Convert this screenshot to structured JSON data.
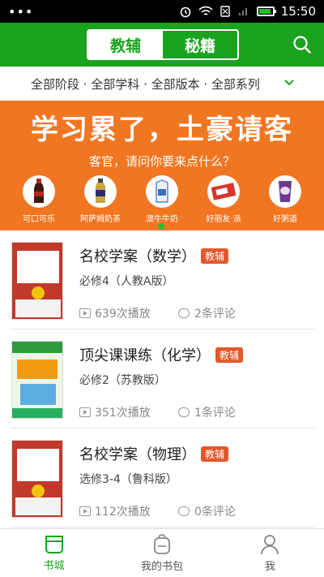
{
  "status_bar": {
    "time": "15:50",
    "dots": "•••"
  },
  "header": {
    "tabs": [
      {
        "label": "教辅",
        "active": true
      },
      {
        "label": "秘籍",
        "active": false
      }
    ]
  },
  "filter": {
    "text": "全部阶段 · 全部学科 · 全部版本 · 全部系列"
  },
  "banner": {
    "title": "学习累了，土豪请客",
    "subtitle": "客官，请问你要来点什么？",
    "products": [
      {
        "label": "可口可乐",
        "color": "#b3261e"
      },
      {
        "label": "阿萨姆奶茶",
        "color": "#c9a24a"
      },
      {
        "label": "澳牛牛奶",
        "color": "#3b6fb6"
      },
      {
        "label": "好丽友·派",
        "color": "#d9342b"
      },
      {
        "label": "好粥道",
        "color": "#6a3a8c"
      }
    ]
  },
  "items": [
    {
      "title": "名校学案（数学）",
      "tag": "教辅",
      "edition": "必修4（人教A版）",
      "plays": "639次播放",
      "comments": "2条评论",
      "cover_text": "名校学案",
      "cover_color": "#c0392b"
    },
    {
      "title": "顶尖课课练（化学）",
      "tag": "教辅",
      "edition": "必修2（苏教版）",
      "plays": "351次播放",
      "comments": "1条评论",
      "cover_text": "顶尖课课练",
      "cover_color": "#2e9b3d"
    },
    {
      "title": "名校学案（物理）",
      "tag": "教辅",
      "edition": "选修3-4（鲁科版）",
      "plays": "112次播放",
      "comments": "0条评论",
      "cover_text": "名校学案",
      "cover_color": "#c0392b"
    }
  ],
  "bottom_nav": [
    {
      "label": "书城",
      "icon": "bookstore-icon",
      "active": true
    },
    {
      "label": "我的书包",
      "icon": "backpack-icon",
      "active": false
    },
    {
      "label": "我",
      "icon": "user-icon",
      "active": false
    }
  ],
  "colors": {
    "brand": "#1aa31f",
    "banner": "#f17622",
    "tag": "#e2582a"
  }
}
